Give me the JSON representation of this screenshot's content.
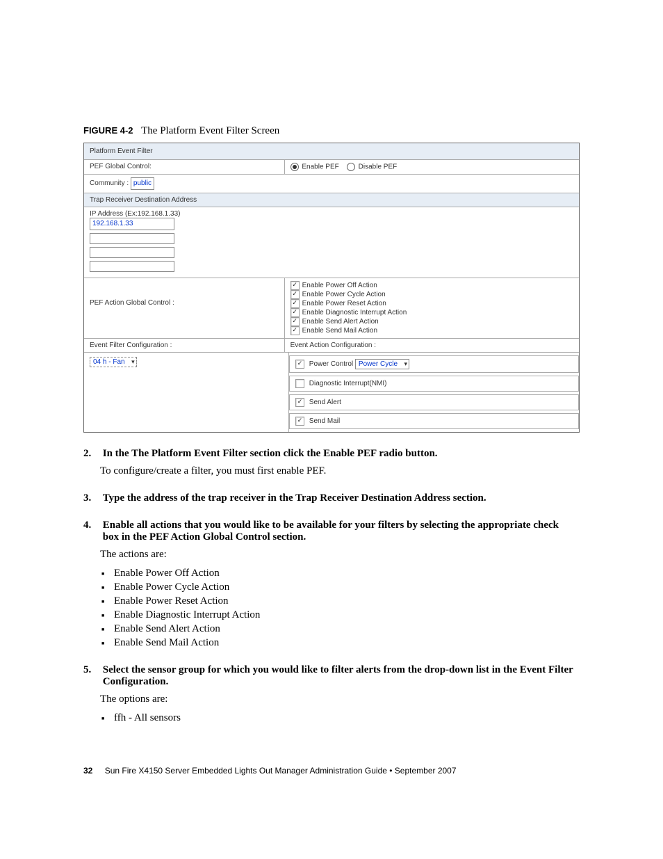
{
  "figure": {
    "number": "FIGURE 4-2",
    "title": "The Platform Event Filter Screen"
  },
  "screenshot": {
    "header": "Platform Event Filter",
    "row_pef_global": "PEF Global Control:",
    "radio_enable": "Enable PEF",
    "radio_disable": "Disable PEF",
    "row_community": "Community :",
    "community_value": "public",
    "row_trap": "Trap Receiver Destination Address",
    "ip_label": "IP Address (Ex:192.168.1.33)",
    "ip_value": "192.168.1.33",
    "row_action_global": "PEF Action Global Control :",
    "actions": [
      "Enable Power Off Action",
      "Enable Power Cycle Action",
      "Enable Power Reset Action",
      "Enable Diagnostic Interrupt Action",
      "Enable Send Alert Action",
      "Enable Send Mail Action"
    ],
    "row_evfilter": "Event Filter Configuration :",
    "sel_value": "04 h - Fan",
    "row_evaction": "Event Action Configuration :",
    "ea_power_control": "Power Control",
    "ea_power_sel": "Power Cycle",
    "ea_diag": "Diagnostic Interrupt(NMI)",
    "ea_alert": "Send Alert",
    "ea_mail": "Send Mail"
  },
  "steps": {
    "s2": "In the The Platform Event Filter section click the Enable PEF radio button.",
    "s2_sub": "To configure/create a filter, you must first enable PEF.",
    "s3": "Type the address of the trap receiver in the Trap Receiver Destination Address section.",
    "s4": "Enable all actions that you would like to be available for your filters by selecting the appropriate check box in the PEF Action Global Control section.",
    "s4_sub": "The actions are:",
    "s4_list": [
      "Enable Power Off Action",
      "Enable Power Cycle Action",
      "Enable Power Reset Action",
      "Enable Diagnostic Interrupt Action",
      "Enable Send Alert Action",
      "Enable Send Mail Action"
    ],
    "s5": "Select the sensor group for which you would like to filter alerts from the drop-down list in the Event Filter Configuration.",
    "s5_sub": "The options are:",
    "s5_list": [
      "ffh - All sensors"
    ]
  },
  "footer": {
    "pagenum": "32",
    "text": "Sun Fire X4150 Server Embedded Lights Out Manager Administration Guide • September 2007"
  }
}
